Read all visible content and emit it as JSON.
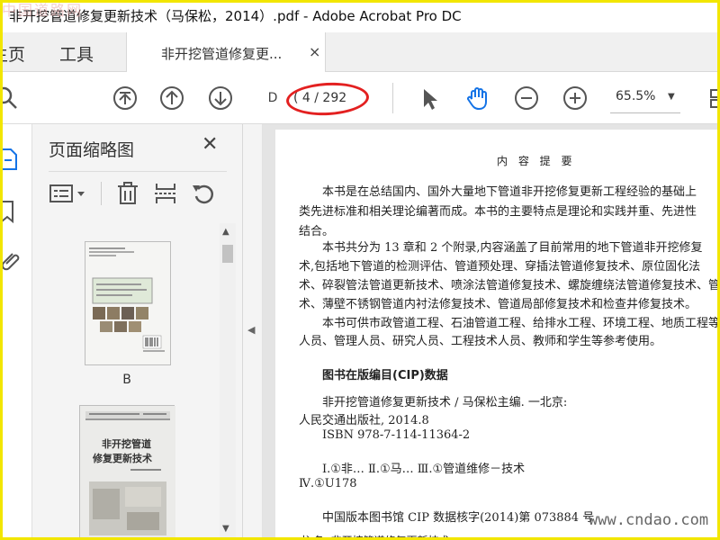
{
  "window": {
    "title": "非开挖管道修复更新技术（马保松，2014）.pdf - Adobe Acrobat Pro DC",
    "watermark_top": "中国道路网"
  },
  "nav": {
    "home": "主页",
    "tools": "工具"
  },
  "tab": {
    "label": "非开挖管道修复更...",
    "close": "×"
  },
  "toolbar": {
    "page_input": "D",
    "page_count": "( 4 / 292",
    "zoom": "65.5%",
    "icons": [
      "search-icon",
      "first-page-icon",
      "prev-page-icon",
      "next-page-icon",
      "select-cursor-icon",
      "hand-tool-icon",
      "zoom-out-icon",
      "zoom-in-icon"
    ]
  },
  "panel": {
    "title": "页面缩略图",
    "close": "✕",
    "thumb1_label": "B"
  },
  "document": {
    "heading": "内 容 提 要",
    "lines": [
      "本书是在总结国内、国外大量地下管道非开挖修复更新工程经验的基础上",
      "类先进标准和相关理论编著而成。本书的主要特点是理论和实践并重、先进性",
      "结合。",
      "本书共分为 13 章和 2 个附录,内容涵盖了目前常用的地下管道非开挖修复",
      "术,包括地下管道的检测评估、管道预处理、穿插法管道修复技术、原位固化法",
      "术、碎裂管法管道更新技术、喷涂法管道修复技术、螺旋缠绕法管道修复技术、管",
      "术、薄壁不锈钢管道内衬法修复技术、管道局部修复技术和检查井修复技术。",
      "本书可供市政管道工程、石油管道工程、给排水工程、环境工程、地质工程等",
      "人员、管理人员、研究人员、工程技术人员、教师和学生等参考使用。"
    ],
    "cip_heading": "图书在版编目(CIP)数据",
    "cip_lines": [
      "非开挖管道修复更新技术 / 马保松主编. 一北京:",
      "人民交通出版社, 2014.8",
      "ISBN 978-7-114-11364-2",
      "Ⅰ.①非…   Ⅱ.①马…   Ⅲ.①管道维修－技术",
      "Ⅳ.①U178",
      "中国版本图书馆 CIP 数据核字(2014)第 073884 号"
    ],
    "bottom_cut": "书    名:  非开挖管道修复更新技术"
  },
  "watermark_br": "www.cndao.com",
  "colors": {
    "accent": "#1473e6",
    "annotation": "#e32020",
    "frame": "#f2e600"
  }
}
